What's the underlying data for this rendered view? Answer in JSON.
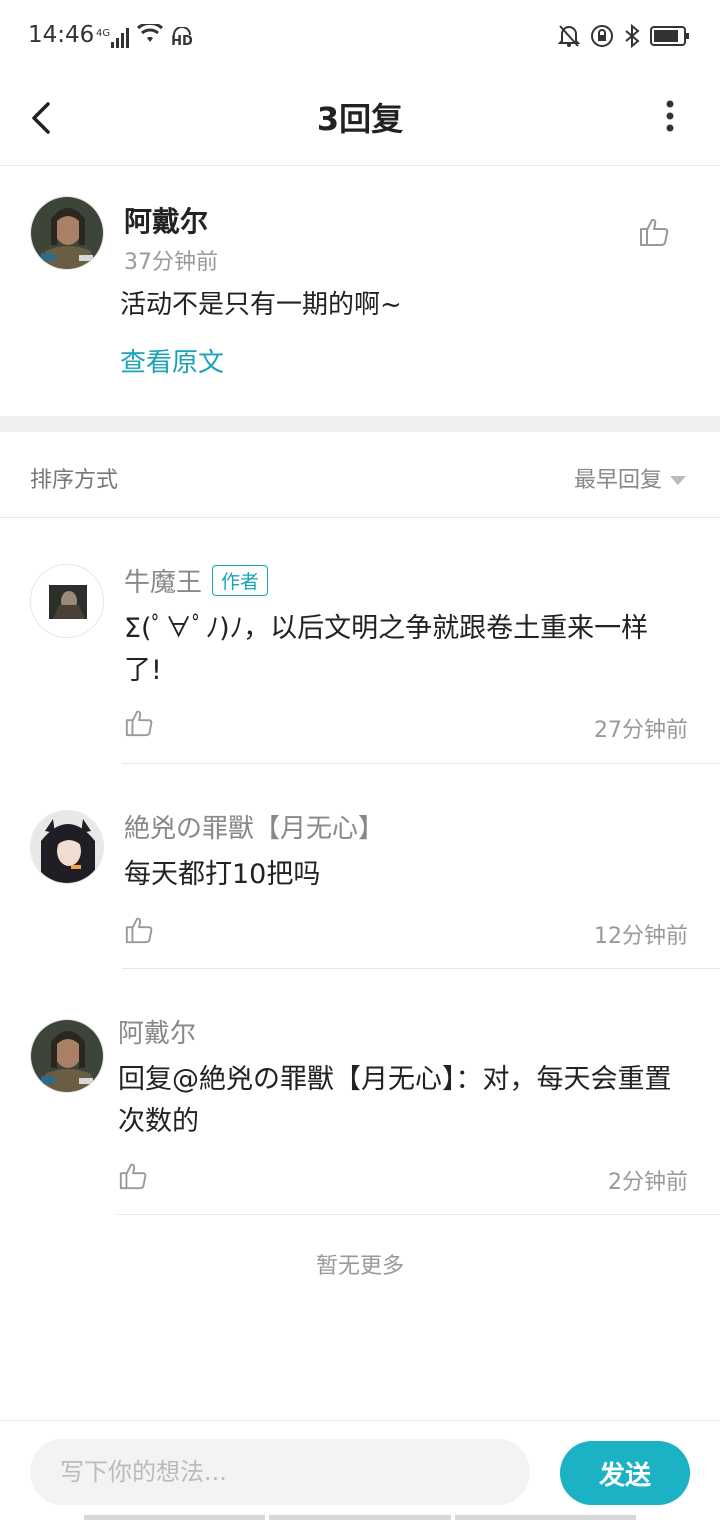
{
  "statusbar": {
    "time": "14:46",
    "network": "4G",
    "hd": "HD",
    "icons": [
      "signal-icon",
      "wifi-icon",
      "hd-icon",
      "mute-icon",
      "rotation-lock-icon",
      "bluetooth-icon",
      "battery-icon"
    ]
  },
  "header": {
    "title": "3回复"
  },
  "post": {
    "author": "阿戴尔",
    "time": "37分钟前",
    "content": "活动不是只有一期的啊~",
    "view_original": "查看原文"
  },
  "sort": {
    "label": "排序方式",
    "selected": "最早回复"
  },
  "replies": [
    {
      "author": "牛魔王",
      "badge": "作者",
      "content": "Σ(ﾟ∀ﾟﾉ)ﾉ，以后文明之争就跟卷土重来一样了!",
      "time": "27分钟前"
    },
    {
      "author": "絶兇の罪獸【月无心】",
      "content": "每天都打10把吗",
      "time": "12分钟前"
    },
    {
      "author": "阿戴尔",
      "content": "回复@絶兇の罪獸【月无心】：对，每天会重置次数的",
      "time": "2分钟前"
    }
  ],
  "no_more": "暂无更多",
  "input": {
    "placeholder": "写下你的想法...",
    "send_label": "发送"
  },
  "colors": {
    "accent": "#1ab2c4",
    "link": "#1aa3b8"
  }
}
